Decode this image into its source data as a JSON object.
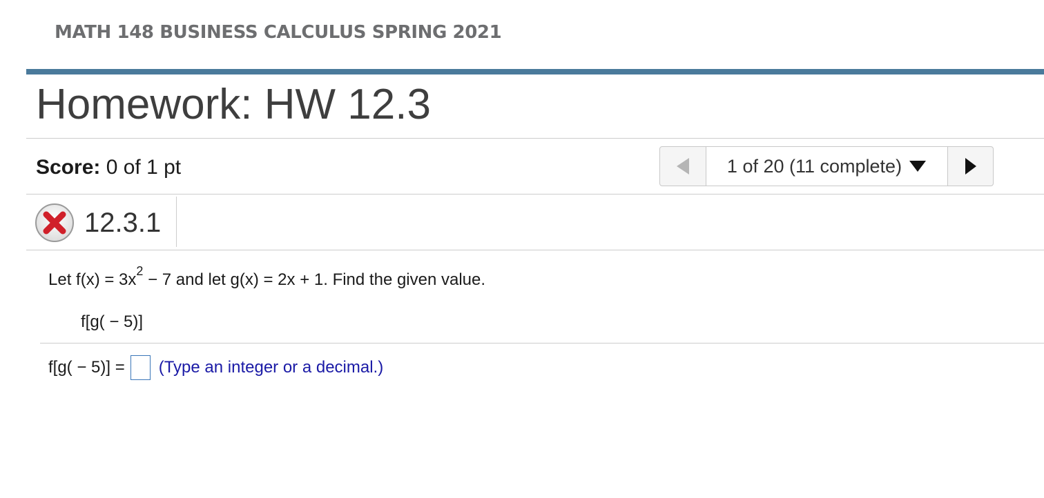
{
  "course": {
    "title": "MATH 148 BUSINESS CALCULUS SPRING 2021"
  },
  "homework": {
    "title": "Homework: HW 12.3"
  },
  "score": {
    "label": "Score:",
    "value": "0 of 1 pt"
  },
  "navigation": {
    "prev_icon": "triangle-left-icon",
    "next_icon": "triangle-right-icon",
    "selector_label": "1 of 20 (11 complete)",
    "selector_icon": "triangle-down-icon"
  },
  "question": {
    "status_icon": "incorrect-x-icon",
    "status_color": "#d0202a",
    "id": "12.3.1",
    "prompt_part1": "Let f(x) = 3x",
    "prompt_superscript": "2",
    "prompt_part2": " − 7 and let g(x) = 2x + 1. Find the given value.",
    "expression": "f[g( − 5)]"
  },
  "answer": {
    "label": "f[g( − 5)] =",
    "value": "",
    "hint": "(Type an integer or a decimal.)"
  },
  "colors": {
    "accent_bar": "#4a7a9b",
    "hint_text": "#1a1aa6",
    "input_border": "#3a76b8"
  }
}
